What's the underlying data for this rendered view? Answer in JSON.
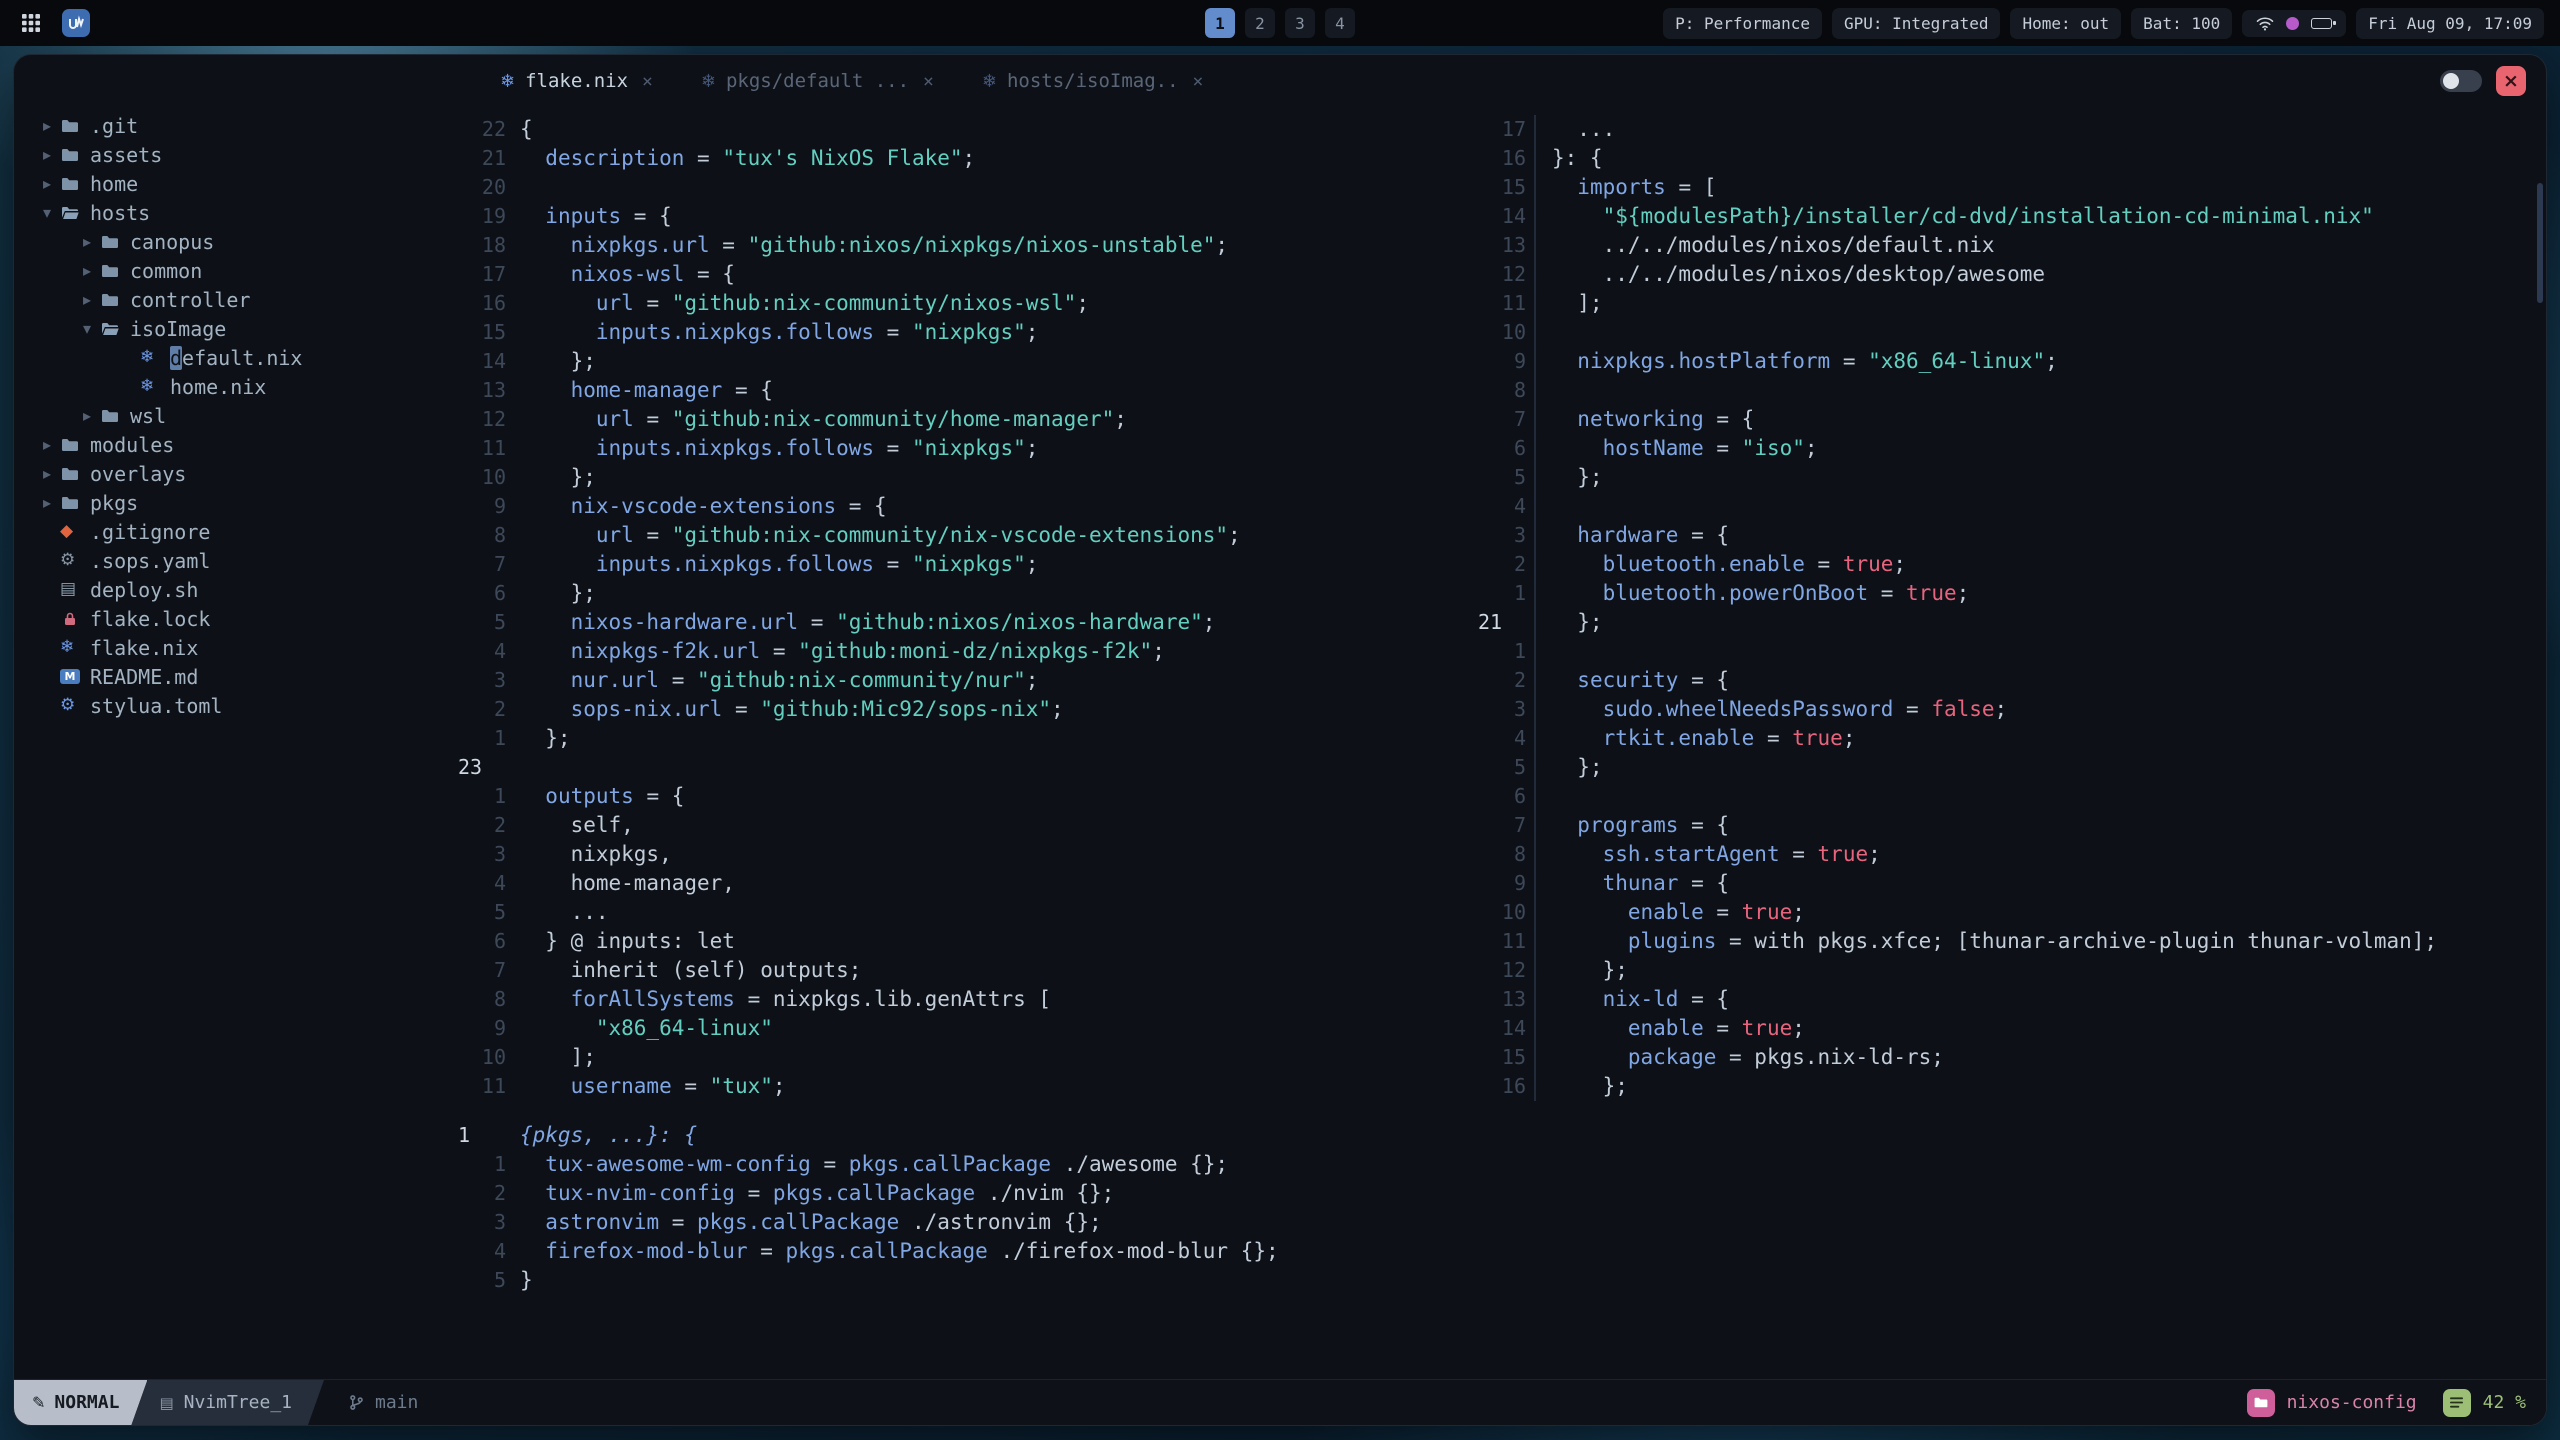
{
  "topbar": {
    "workspaces": {
      "items": [
        "1",
        "2",
        "3",
        "4"
      ],
      "active": 0
    },
    "chips": [
      "P: Performance",
      "GPU: Integrated",
      "Home: out",
      "Bat: 100"
    ],
    "clock": "Fri Aug 09, 17:09"
  },
  "colors": {
    "accent_blue": "#638ccd",
    "attr_blue": "#80a6e4",
    "string_teal": "#63cfc0",
    "boolean_pink": "#e7647e",
    "project_pink": "#cf5f9a",
    "scroll_green": "#9dbf75",
    "close_red": "#e8646e"
  },
  "window": {
    "tabs": [
      {
        "label": "flake.nix",
        "active": true
      },
      {
        "label": "pkgs/default ...",
        "active": false
      },
      {
        "label": "hosts/isoImag..",
        "active": false
      }
    ],
    "tree": [
      {
        "depth": 0,
        "kind": "dir",
        "state": "closed",
        "label": ".git"
      },
      {
        "depth": 0,
        "kind": "dir",
        "state": "closed",
        "label": "assets"
      },
      {
        "depth": 0,
        "kind": "dir",
        "state": "closed",
        "label": "home"
      },
      {
        "depth": 0,
        "kind": "dir",
        "state": "open",
        "label": "hosts"
      },
      {
        "depth": 1,
        "kind": "dir",
        "state": "closed",
        "label": "canopus"
      },
      {
        "depth": 1,
        "kind": "dir",
        "state": "closed",
        "label": "common"
      },
      {
        "depth": 1,
        "kind": "dir",
        "state": "closed",
        "label": "controller"
      },
      {
        "depth": 1,
        "kind": "dir",
        "state": "open",
        "label": "isoImage"
      },
      {
        "depth": 2,
        "kind": "file",
        "icon": "nix",
        "label": "default.nix",
        "cursor": true
      },
      {
        "depth": 2,
        "kind": "file",
        "icon": "nix",
        "label": "home.nix"
      },
      {
        "depth": 1,
        "kind": "dir",
        "state": "closed",
        "label": "wsl"
      },
      {
        "depth": 0,
        "kind": "dir",
        "state": "closed",
        "label": "modules"
      },
      {
        "depth": 0,
        "kind": "dir",
        "state": "closed",
        "label": "overlays"
      },
      {
        "depth": 0,
        "kind": "dir",
        "state": "closed",
        "label": "pkgs"
      },
      {
        "depth": 0,
        "kind": "file",
        "icon": "git",
        "label": ".gitignore"
      },
      {
        "depth": 0,
        "kind": "file",
        "icon": "gear",
        "label": ".sops.yaml"
      },
      {
        "depth": 0,
        "kind": "file",
        "icon": "shell",
        "label": "deploy.sh"
      },
      {
        "depth": 0,
        "kind": "file",
        "icon": "lock",
        "label": "flake.lock"
      },
      {
        "depth": 0,
        "kind": "file",
        "icon": "nix",
        "label": "flake.nix"
      },
      {
        "depth": 0,
        "kind": "file",
        "icon": "markdown",
        "label": "README.md"
      },
      {
        "depth": 0,
        "kind": "file",
        "icon": "toml",
        "label": "stylua.toml"
      }
    ],
    "panes": {
      "left": {
        "lines": [
          {
            "n": "22",
            "t": "{"
          },
          {
            "n": "21",
            "t": "  description = \"tux's NixOS Flake\";"
          },
          {
            "n": "20",
            "t": ""
          },
          {
            "n": "19",
            "t": "  inputs = {"
          },
          {
            "n": "18",
            "t": "    nixpkgs.url = \"github:nixos/nixpkgs/nixos-unstable\";"
          },
          {
            "n": "17",
            "t": "    nixos-wsl = {"
          },
          {
            "n": "16",
            "t": "      url = \"github:nix-community/nixos-wsl\";"
          },
          {
            "n": "15",
            "t": "      inputs.nixpkgs.follows = \"nixpkgs\";"
          },
          {
            "n": "14",
            "t": "    };"
          },
          {
            "n": "13",
            "t": "    home-manager = {"
          },
          {
            "n": "12",
            "t": "      url = \"github:nix-community/home-manager\";"
          },
          {
            "n": "11",
            "t": "      inputs.nixpkgs.follows = \"nixpkgs\";"
          },
          {
            "n": "10",
            "t": "    };"
          },
          {
            "n": "9",
            "t": "    nix-vscode-extensions = {"
          },
          {
            "n": "8",
            "t": "      url = \"github:nix-community/nix-vscode-extensions\";"
          },
          {
            "n": "7",
            "t": "      inputs.nixpkgs.follows = \"nixpkgs\";"
          },
          {
            "n": "6",
            "t": "    };"
          },
          {
            "n": "5",
            "t": "    nixos-hardware.url = \"github:nixos/nixos-hardware\";"
          },
          {
            "n": "4",
            "t": "    nixpkgs-f2k.url = \"github:moni-dz/nixpkgs-f2k\";"
          },
          {
            "n": "3",
            "t": "    nur.url = \"github:nix-community/nur\";"
          },
          {
            "n": "2",
            "t": "    sops-nix.url = \"github:Mic92/sops-nix\";"
          },
          {
            "n": "1",
            "t": "  };"
          },
          {
            "n": "23",
            "t": "",
            "cur": true
          },
          {
            "n": "1",
            "t": "  outputs = {"
          },
          {
            "n": "2",
            "t": "    self,"
          },
          {
            "n": "3",
            "t": "    nixpkgs,"
          },
          {
            "n": "4",
            "t": "    home-manager,"
          },
          {
            "n": "5",
            "t": "    ..."
          },
          {
            "n": "6",
            "t": "  } @ inputs: let"
          },
          {
            "n": "7",
            "t": "    inherit (self) outputs;"
          },
          {
            "n": "8",
            "t": "    forAllSystems = nixpkgs.lib.genAttrs ["
          },
          {
            "n": "9",
            "t": "      \"x86_64-linux\""
          },
          {
            "n": "10",
            "t": "    ];"
          },
          {
            "n": "11",
            "t": "    username = \"tux\";"
          }
        ]
      },
      "right": {
        "lines": [
          {
            "n": "17",
            "t": "  ..."
          },
          {
            "n": "16",
            "t": "}: {"
          },
          {
            "n": "15",
            "t": "  imports = ["
          },
          {
            "n": "14",
            "t": "    \"${modulesPath}/installer/cd-dvd/installation-cd-minimal.nix\""
          },
          {
            "n": "13",
            "t": "    ../../modules/nixos/default.nix"
          },
          {
            "n": "12",
            "t": "    ../../modules/nixos/desktop/awesome"
          },
          {
            "n": "11",
            "t": "  ];"
          },
          {
            "n": "10",
            "t": ""
          },
          {
            "n": "9",
            "t": "  nixpkgs.hostPlatform = \"x86_64-linux\";"
          },
          {
            "n": "8",
            "t": ""
          },
          {
            "n": "7",
            "t": "  networking = {"
          },
          {
            "n": "6",
            "t": "    hostName = \"iso\";"
          },
          {
            "n": "5",
            "t": "  };"
          },
          {
            "n": "4",
            "t": ""
          },
          {
            "n": "3",
            "t": "  hardware = {"
          },
          {
            "n": "2",
            "t": "    bluetooth.enable = true;"
          },
          {
            "n": "1",
            "t": "    bluetooth.powerOnBoot = true;"
          },
          {
            "n": "21",
            "t": "  };",
            "cur": true
          },
          {
            "n": "1",
            "t": ""
          },
          {
            "n": "2",
            "t": "  security = {"
          },
          {
            "n": "3",
            "t": "    sudo.wheelNeedsPassword = false;"
          },
          {
            "n": "4",
            "t": "    rtkit.enable = true;"
          },
          {
            "n": "5",
            "t": "  };"
          },
          {
            "n": "6",
            "t": ""
          },
          {
            "n": "7",
            "t": "  programs = {"
          },
          {
            "n": "8",
            "t": "    ssh.startAgent = true;"
          },
          {
            "n": "9",
            "t": "    thunar = {"
          },
          {
            "n": "10",
            "t": "      enable = true;"
          },
          {
            "n": "11",
            "t": "      plugins = with pkgs.xfce; [thunar-archive-plugin thunar-volman];"
          },
          {
            "n": "12",
            "t": "    };"
          },
          {
            "n": "13",
            "t": "    nix-ld = {"
          },
          {
            "n": "14",
            "t": "      enable = true;"
          },
          {
            "n": "15",
            "t": "      package = pkgs.nix-ld-rs;"
          },
          {
            "n": "16",
            "t": "    };"
          }
        ]
      },
      "bottom": {
        "lines": [
          {
            "n": "1",
            "t": "{pkgs, ...}: {",
            "cur": true
          },
          {
            "n": "1",
            "t": "  tux-awesome-wm-config = pkgs.callPackage ./awesome {};"
          },
          {
            "n": "2",
            "t": "  tux-nvim-config = pkgs.callPackage ./nvim {};"
          },
          {
            "n": "3",
            "t": "  astronvim = pkgs.callPackage ./astronvim {};"
          },
          {
            "n": "4",
            "t": "  firefox-mod-blur = pkgs.callPackage ./firefox-mod-blur {};"
          },
          {
            "n": "5",
            "t": "}"
          }
        ]
      }
    },
    "statusline": {
      "mode": "NORMAL",
      "buffer": "NvimTree_1",
      "branch": "main",
      "project": "nixos-config",
      "scroll": "42 %"
    }
  }
}
